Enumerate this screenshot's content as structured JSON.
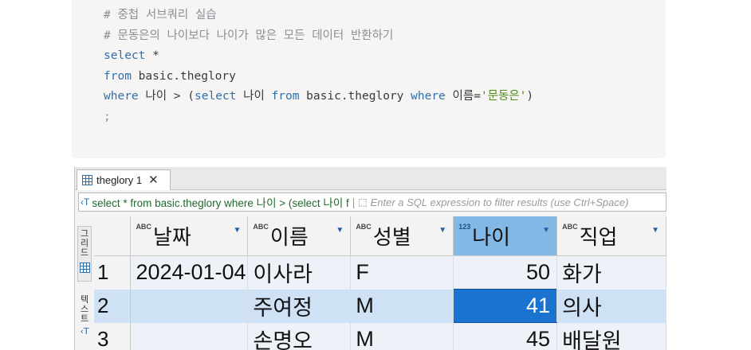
{
  "code": {
    "comment1": "# 중첩 서브쿼리 실습",
    "comment2": "# 문동은의 나이보다 나이가 많은 모든 데이터 반환하기",
    "select_kw": "select",
    "star": " *",
    "from_kw": "from",
    "table_ref": " basic.theglory",
    "where_kw": "where",
    "cond_col": " 나이 > (",
    "sub_select": "select",
    "sub_col": " 나이 ",
    "sub_from": "from",
    "sub_table": " basic.theglory ",
    "sub_where": "where",
    "sub_cond": " 이름=",
    "sub_value": "'문동은'",
    "sub_close": ")",
    "semicolon": ";"
  },
  "tab": {
    "label": "theglory 1",
    "close": "✕"
  },
  "filter": {
    "text": "select * from basic.theglory where 나이 > (select 나이 f",
    "placeholder": "Enter a SQL expression to filter results (use Ctrl+Space)"
  },
  "sidebar": {
    "grid_label": "그리드",
    "text_label": "텍스트"
  },
  "type_badges": {
    "text": "ABC",
    "number": "123"
  },
  "columns": [
    "날짜",
    "이름",
    "성별",
    "나이",
    "직업"
  ],
  "rows": [
    {
      "n": "1",
      "date": "2024-01-04",
      "name": "이사라",
      "gender": "F",
      "age": "50",
      "job": "화가"
    },
    {
      "n": "2",
      "date": "",
      "name": "주여정",
      "gender": "M",
      "age": "41",
      "job": "의사"
    },
    {
      "n": "3",
      "date": "",
      "name": "손명오",
      "gender": "M",
      "age": "45",
      "job": "배달원"
    }
  ],
  "colors": {
    "keyword": "#2f6fae",
    "string": "#4f8a1a",
    "comment": "#8a8f98",
    "selected_header": "#82b8e5",
    "focused_cell": "#1a73cf"
  }
}
